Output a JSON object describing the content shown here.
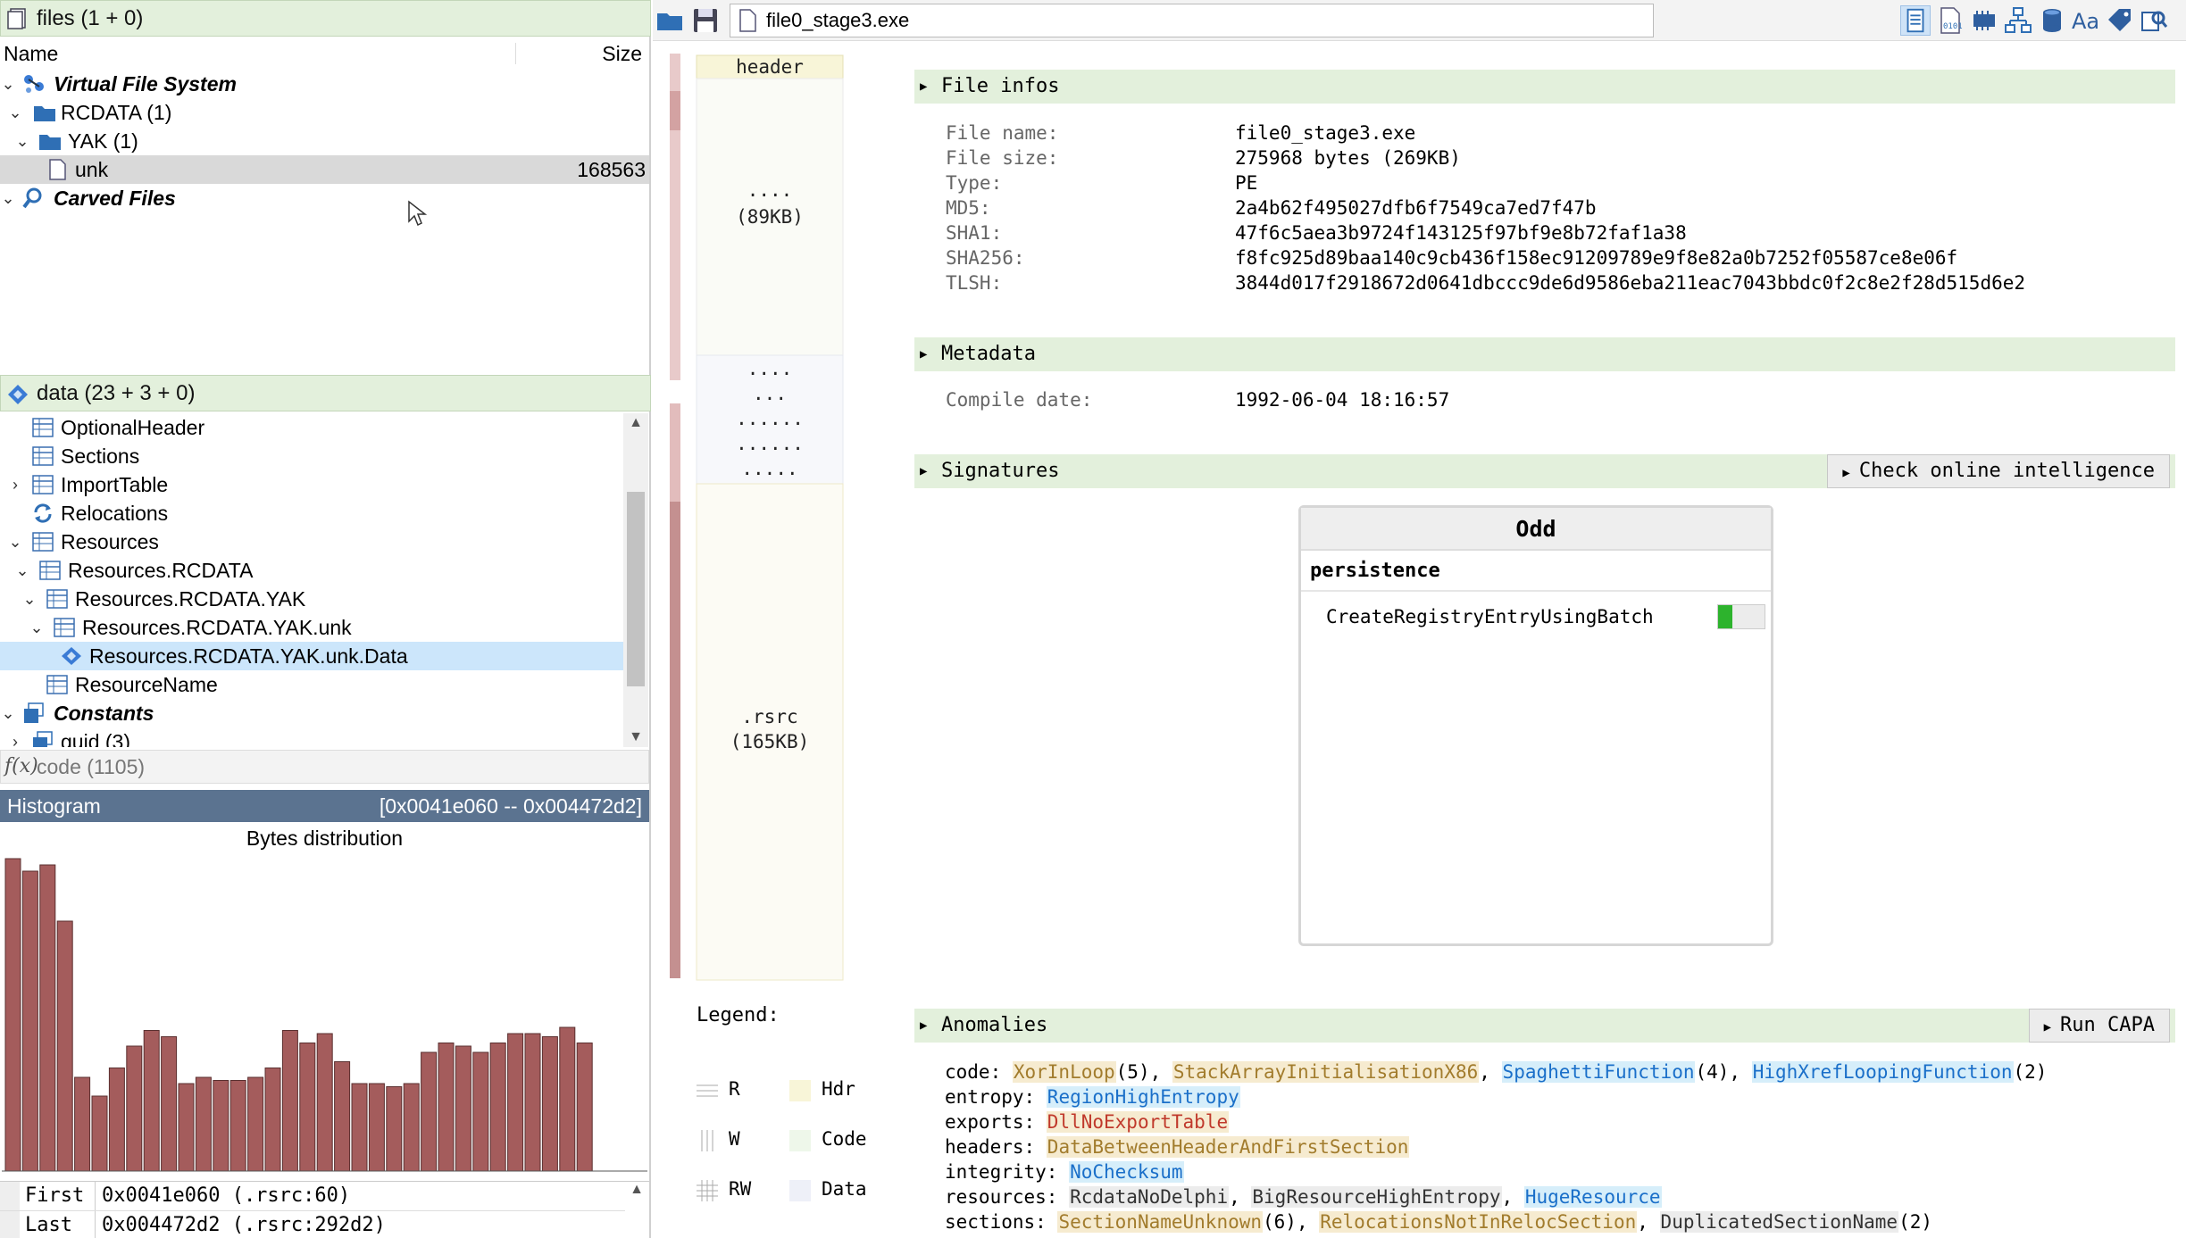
{
  "files_panel": {
    "header": "files (1 + 0)",
    "col_name": "Name",
    "col_size": "Size",
    "items": [
      {
        "label": "Virtual File System"
      },
      {
        "label": "RCDATA (1)"
      },
      {
        "label": "YAK (1)"
      },
      {
        "label": "unk",
        "size": "168563"
      },
      {
        "label": "Carved Files"
      }
    ]
  },
  "data_panel": {
    "header": "data (23 + 3 + 0)",
    "items": [
      {
        "label": "OptionalHeader"
      },
      {
        "label": "Sections"
      },
      {
        "label": "ImportTable"
      },
      {
        "label": "Relocations"
      },
      {
        "label": "Resources"
      },
      {
        "label": "Resources.RCDATA"
      },
      {
        "label": "Resources.RCDATA.YAK"
      },
      {
        "label": "Resources.RCDATA.YAK.unk"
      },
      {
        "label": "Resources.RCDATA.YAK.unk.Data"
      },
      {
        "label": "ResourceName"
      },
      {
        "label": "Constants"
      },
      {
        "label": "guid (3)"
      }
    ]
  },
  "code_panel": {
    "fx": "f(x)",
    "label": "code (1105)"
  },
  "histogram": {
    "title": "Histogram",
    "range": "[0x0041e060 -- 0x004472d2]",
    "chart_title": "Bytes distribution",
    "bar_color": "#a45c5c",
    "values": [
      100,
      96,
      98,
      80,
      30,
      24,
      33,
      40,
      45,
      43,
      28,
      30,
      29,
      29,
      30,
      33,
      45,
      41,
      44,
      35,
      28,
      28,
      27,
      28,
      38,
      41,
      40,
      38,
      41,
      44,
      44,
      43,
      46,
      41
    ]
  },
  "first_last": {
    "rows": [
      {
        "key": "First",
        "value": "0x0041e060 (.rsrc:60)"
      },
      {
        "key": "Last",
        "value": "0x004472d2 (.rsrc:292d2)"
      }
    ]
  },
  "toolbar": {
    "path": "file0_stage3.exe",
    "icons": [
      "open-folder-icon",
      "save-icon",
      "file-info-icon",
      "hex-view-icon",
      "chip-icon",
      "graph-icon",
      "database-icon",
      "text-icon",
      "tag-icon",
      "search-icon"
    ]
  },
  "map": {
    "labels": [
      "header",
      "....",
      "(89KB)",
      "....",
      "...",
      "......",
      "......",
      ".....",
      ".rsrc",
      "(165KB)"
    ],
    "legend_title": "Legend:",
    "legend": [
      {
        "left": "R",
        "right": "Hdr"
      },
      {
        "left": "W",
        "right": "Code"
      },
      {
        "left": "RW",
        "right": "Data"
      }
    ]
  },
  "file_infos": {
    "title": "File infos",
    "rows": [
      {
        "k": "File name:",
        "v": "file0_stage3.exe"
      },
      {
        "k": "File size:",
        "v": "275968 bytes (269KB)"
      },
      {
        "k": "Type:",
        "v": "PE"
      },
      {
        "k": "MD5:",
        "v": "2a4b62f495027dfb6f7549ca7ed7f47b"
      },
      {
        "k": "SHA1:",
        "v": "47f6c5aea3b9724f143125f97bf9e8b72faf1a38"
      },
      {
        "k": "SHA256:",
        "v": "f8fc925d89baa140c9cb436f158ec91209789e9f8e82a0b7252f05587ce8e06f"
      },
      {
        "k": "TLSH:",
        "v": "3844d017f2918672d0641dbccc9de6d9586eba211eac7043bbdc0f2c8e2f28d515d6e2"
      }
    ]
  },
  "metadata": {
    "title": "Metadata",
    "rows": [
      {
        "k": "Compile date:",
        "v": "1992-06-04 18:16:57"
      }
    ]
  },
  "signatures": {
    "title": "Signatures",
    "button": "Check online intelligence",
    "box_title": "Odd",
    "category": "persistence",
    "rule": "CreateRegistryEntryUsingBatch",
    "rule_level": 0.3
  },
  "anomalies": {
    "title": "Anomalies",
    "button": "Run CAPA",
    "rows": [
      {
        "key": "code:",
        "items": [
          {
            "t": "XorInLoop",
            "c": "tan",
            "s": "(5), "
          },
          {
            "t": "StackArrayInitialisationX86",
            "c": "tan",
            "s": ", "
          },
          {
            "t": "SpaghettiFunction",
            "c": "blue",
            "s": "(4), "
          },
          {
            "t": "HighXrefLoopingFunction",
            "c": "blue",
            "s": "(2)"
          }
        ]
      },
      {
        "key": "entropy:",
        "items": [
          {
            "t": "RegionHighEntropy",
            "c": "blue",
            "s": ""
          }
        ]
      },
      {
        "key": "exports:",
        "items": [
          {
            "t": "DllNoExportTable",
            "c": "red",
            "s": ""
          }
        ]
      },
      {
        "key": "headers:",
        "items": [
          {
            "t": "DataBetweenHeaderAndFirstSection",
            "c": "tan",
            "s": ""
          }
        ]
      },
      {
        "key": "integrity:",
        "items": [
          {
            "t": "NoChecksum",
            "c": "blue",
            "s": ""
          }
        ]
      },
      {
        "key": "resources:",
        "items": [
          {
            "t": "RcdataNoDelphi",
            "c": "grey",
            "s": ", "
          },
          {
            "t": "BigResourceHighEntropy",
            "c": "grey",
            "s": ", "
          },
          {
            "t": "HugeResource",
            "c": "blue",
            "s": ""
          }
        ]
      },
      {
        "key": "sections:",
        "items": [
          {
            "t": "SectionNameUnknown",
            "c": "tan",
            "s": "(6), "
          },
          {
            "t": "RelocationsNotInRelocSection",
            "c": "tan",
            "s": ", "
          },
          {
            "t": "DuplicatedSectionName",
            "c": "grey",
            "s": "(2)"
          }
        ]
      }
    ]
  }
}
